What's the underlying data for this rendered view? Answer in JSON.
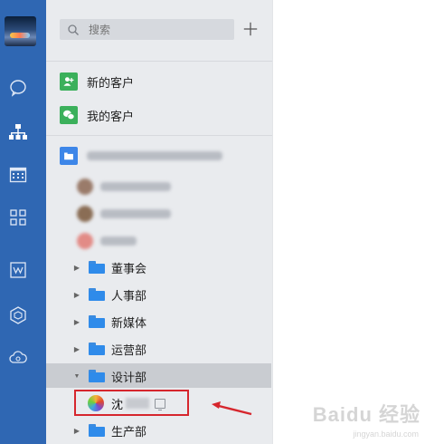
{
  "search": {
    "placeholder": "搜索"
  },
  "menu": {
    "new_customers": "新的客户",
    "my_customers": "我的客户"
  },
  "departments": [
    {
      "name": "董事会"
    },
    {
      "name": "人事部"
    },
    {
      "name": "新媒体"
    },
    {
      "name": "运营部"
    },
    {
      "name": "设计部"
    },
    {
      "name": "生产部"
    }
  ],
  "selected_member": {
    "name": "沈"
  },
  "watermark": {
    "text": "Baidu 经验",
    "sub": "jingyan.baidu.com"
  },
  "colors": {
    "rail": "#2f67b3",
    "panel": "#e9ebee",
    "accent_blue": "#2f8bea",
    "accent_green": "#3bb05b",
    "annotation_red": "#d6262d"
  }
}
